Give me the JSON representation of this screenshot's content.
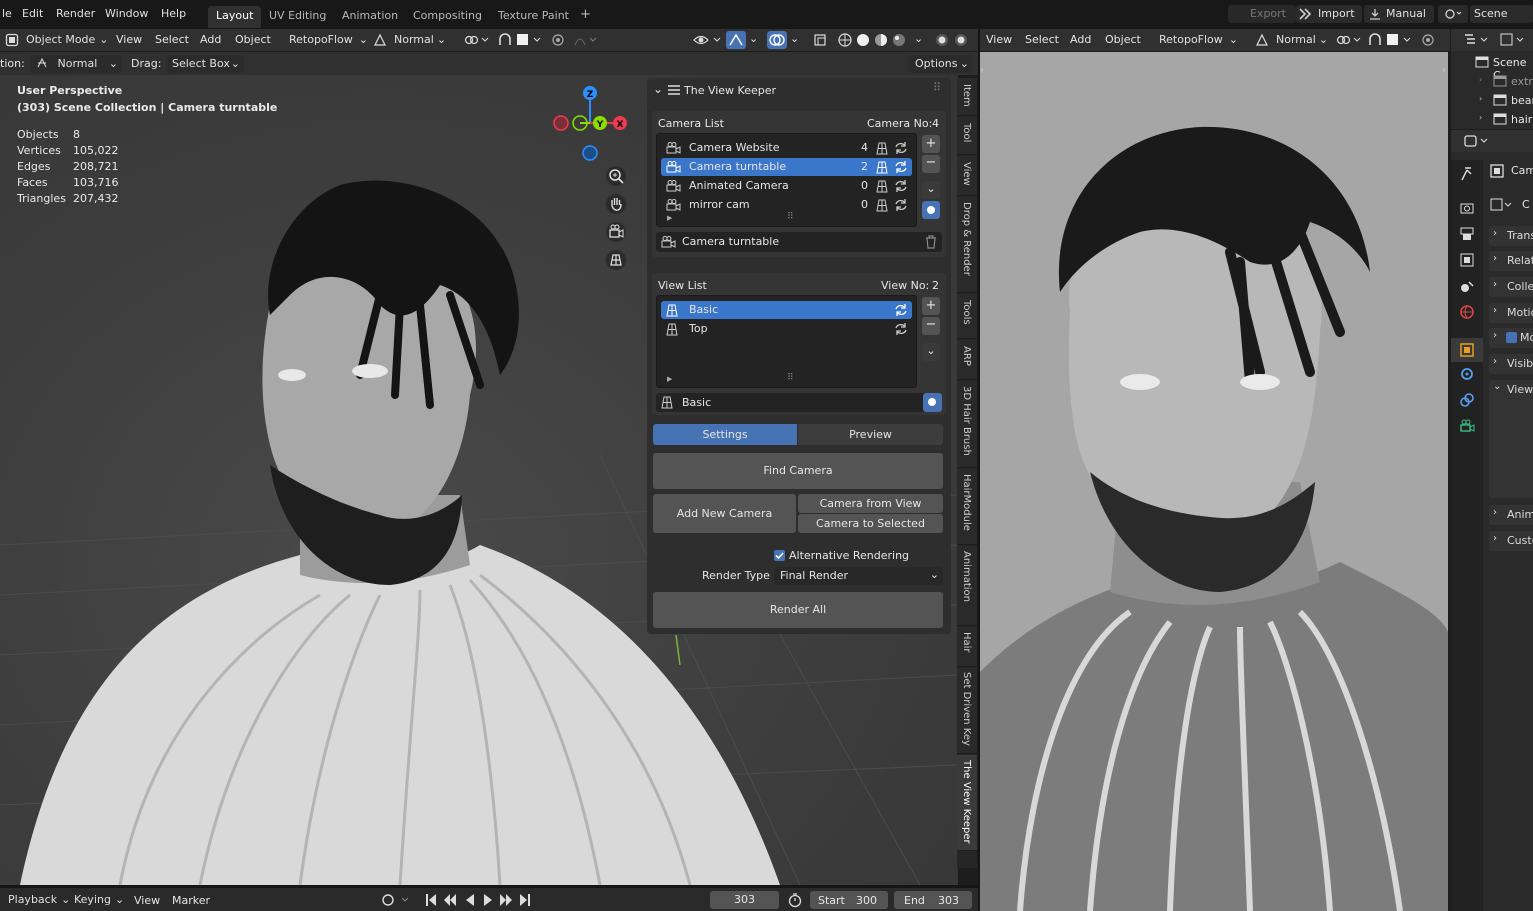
{
  "menubar": {
    "items": [
      "le",
      "Edit",
      "Render",
      "Window",
      "Help"
    ],
    "workspaces": [
      "Layout",
      "UV Editing",
      "Animation",
      "Compositing",
      "Texture Paint"
    ],
    "active_workspace": "Layout",
    "add_workspace": "+",
    "export": "Export",
    "import": "Import",
    "manual": "Manual",
    "scene": "Scene"
  },
  "viewport_header": {
    "mode": "Object Mode",
    "menus": [
      "View",
      "Select",
      "Add",
      "Object"
    ],
    "retopoflow": "RetopoFlow",
    "orientation": "Normal"
  },
  "tool_header": {
    "orientation_label": "tion:",
    "orientation_value": "Normal",
    "drag_label": "Drag:",
    "drag_value": "Select Box",
    "options": "Options"
  },
  "overlay": {
    "perspective": "User Perspective",
    "collection": "(303) Scene Collection | Camera turntable",
    "stats": [
      {
        "label": "Objects",
        "value": "8"
      },
      {
        "label": "Vertices",
        "value": "105,022"
      },
      {
        "label": "Edges",
        "value": "208,721"
      },
      {
        "label": "Faces",
        "value": "103,716"
      },
      {
        "label": "Triangles",
        "value": "207,432"
      }
    ],
    "gizmo": {
      "z": "Z",
      "y": "Y",
      "x": "X"
    }
  },
  "view_keeper": {
    "title": "The View Keeper",
    "camera_list_label": "Camera List",
    "camera_no_label": "Camera No:",
    "camera_no": "4",
    "cameras": [
      {
        "name": "Camera Website",
        "count": "4",
        "selected": false
      },
      {
        "name": "Camera turntable",
        "count": "2",
        "selected": true
      },
      {
        "name": "Animated Camera",
        "count": "0",
        "selected": false
      },
      {
        "name": "mirror cam",
        "count": "0",
        "selected": false
      }
    ],
    "active_camera": "Camera turntable",
    "view_list_label": "View List",
    "view_no_label": "View No:",
    "view_no": "2",
    "views": [
      {
        "name": "Basic",
        "selected": true
      },
      {
        "name": "Top",
        "selected": false
      }
    ],
    "active_view": "Basic",
    "tab_settings": "Settings",
    "tab_preview": "Preview",
    "find_camera": "Find Camera",
    "add_new_camera": "Add New Camera",
    "camera_from_view": "Camera from View",
    "camera_to_selected": "Camera to Selected",
    "alt_rendering": "Alternative Rendering",
    "render_type_label": "Render Type",
    "render_type_value": "Final Render",
    "render_all": "Render All"
  },
  "sidebar_tabs": [
    "Item",
    "Tool",
    "View",
    "Drop & Render",
    "Tools",
    "ARP",
    "3D Hair Brush",
    "HairModule",
    "Animation",
    "Hair",
    "Set Driven Key",
    "The View Keeper"
  ],
  "right_header": {
    "menus": [
      "View",
      "Select",
      "Add",
      "Object"
    ],
    "retopoflow": "RetopoFlow",
    "orientation": "Normal"
  },
  "outliner": {
    "root": "Scene C",
    "items": [
      "extr",
      "bear",
      "hair"
    ]
  },
  "properties": {
    "object": "Cam",
    "data": "C",
    "sections": [
      "Trans",
      "Relati",
      "Colle",
      "Motio",
      "Mo",
      "Visib",
      "View",
      "Anim",
      "Custo"
    ]
  },
  "timeline": {
    "playback": "Playback",
    "keying": "Keying",
    "view": "View",
    "marker": "Marker",
    "current_frame": "303",
    "start_label": "Start",
    "start": "300",
    "end_label": "End",
    "end": "303"
  },
  "colors": {
    "accent": "#4772b3",
    "selection": "#3a76ca",
    "gizmo_x": "#ee3a4f",
    "gizmo_y": "#8bdc00",
    "gizmo_z": "#2c8fff"
  }
}
